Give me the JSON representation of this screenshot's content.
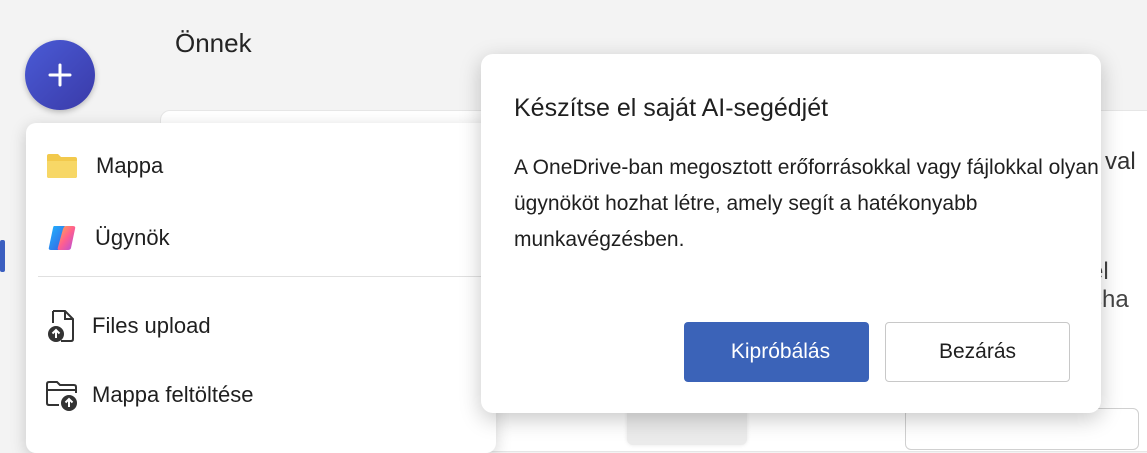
{
  "page": {
    "title": "Önnek"
  },
  "background": {
    "partial_text_1": "val",
    "partial_text_2": "el sha"
  },
  "new_button": {
    "icon": "plus-icon"
  },
  "menu": {
    "items": [
      {
        "label": "Mappa",
        "icon": "folder-icon"
      },
      {
        "label": "Ügynök",
        "icon": "copilot-icon"
      },
      {
        "label": "Files upload",
        "icon": "file-upload-icon"
      },
      {
        "label": "Mappa feltöltése",
        "icon": "folder-upload-icon"
      }
    ]
  },
  "callout": {
    "title": "Készítse el saját AI-segédjét",
    "body": "A OneDrive-ban megosztott erőforrásokkal vagy fájlokkal olyan ügynököt hozhat létre, amely segít a hatékonyabb munkavégzésben.",
    "primary_label": "Kipróbálás",
    "secondary_label": "Bezárás"
  },
  "colors": {
    "accent": "#3b63b8",
    "new_button": "#4a5bd6",
    "folder": "#f2c94c"
  }
}
